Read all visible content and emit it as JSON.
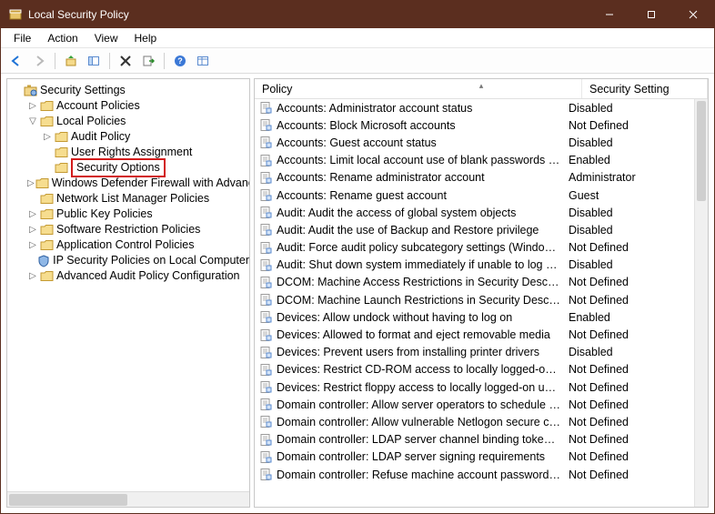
{
  "window": {
    "title": "Local Security Policy"
  },
  "menu": {
    "items": [
      "File",
      "Action",
      "View",
      "Help"
    ]
  },
  "tree": {
    "root_label": "Security Settings",
    "nodes": [
      {
        "label": "Account Policies",
        "depth": 1,
        "exp": ">",
        "icon": "folder"
      },
      {
        "label": "Local Policies",
        "depth": 1,
        "exp": "v",
        "icon": "folder"
      },
      {
        "label": "Audit Policy",
        "depth": 2,
        "exp": ">",
        "icon": "folder"
      },
      {
        "label": "User Rights Assignment",
        "depth": 2,
        "exp": "",
        "icon": "folder"
      },
      {
        "label": "Security Options",
        "depth": 2,
        "exp": "",
        "icon": "folder",
        "selected": true
      },
      {
        "label": "Windows Defender Firewall with Advanced Security",
        "depth": 1,
        "exp": ">",
        "icon": "folder"
      },
      {
        "label": "Network List Manager Policies",
        "depth": 1,
        "exp": "",
        "icon": "folder"
      },
      {
        "label": "Public Key Policies",
        "depth": 1,
        "exp": ">",
        "icon": "folder"
      },
      {
        "label": "Software Restriction Policies",
        "depth": 1,
        "exp": ">",
        "icon": "folder"
      },
      {
        "label": "Application Control Policies",
        "depth": 1,
        "exp": ">",
        "icon": "folder"
      },
      {
        "label": "IP Security Policies on Local Computer",
        "depth": 1,
        "exp": "",
        "icon": "shield"
      },
      {
        "label": "Advanced Audit Policy Configuration",
        "depth": 1,
        "exp": ">",
        "icon": "folder"
      }
    ]
  },
  "list": {
    "columns": {
      "policy": "Policy",
      "setting": "Security Setting"
    },
    "rows": [
      {
        "policy": "Accounts: Administrator account status",
        "setting": "Disabled"
      },
      {
        "policy": "Accounts: Block Microsoft accounts",
        "setting": "Not Defined"
      },
      {
        "policy": "Accounts: Guest account status",
        "setting": "Disabled"
      },
      {
        "policy": "Accounts: Limit local account use of blank passwords to co...",
        "setting": "Enabled"
      },
      {
        "policy": "Accounts: Rename administrator account",
        "setting": "Administrator"
      },
      {
        "policy": "Accounts: Rename guest account",
        "setting": "Guest"
      },
      {
        "policy": "Audit: Audit the access of global system objects",
        "setting": "Disabled"
      },
      {
        "policy": "Audit: Audit the use of Backup and Restore privilege",
        "setting": "Disabled"
      },
      {
        "policy": "Audit: Force audit policy subcategory settings (Windows Vis...",
        "setting": "Not Defined"
      },
      {
        "policy": "Audit: Shut down system immediately if unable to log secur...",
        "setting": "Disabled"
      },
      {
        "policy": "DCOM: Machine Access Restrictions in Security Descriptor D...",
        "setting": "Not Defined"
      },
      {
        "policy": "DCOM: Machine Launch Restrictions in Security Descriptor ...",
        "setting": "Not Defined"
      },
      {
        "policy": "Devices: Allow undock without having to log on",
        "setting": "Enabled"
      },
      {
        "policy": "Devices: Allowed to format and eject removable media",
        "setting": "Not Defined"
      },
      {
        "policy": "Devices: Prevent users from installing printer drivers",
        "setting": "Disabled"
      },
      {
        "policy": "Devices: Restrict CD-ROM access to locally logged-on user ...",
        "setting": "Not Defined"
      },
      {
        "policy": "Devices: Restrict floppy access to locally logged-on user only",
        "setting": "Not Defined"
      },
      {
        "policy": "Domain controller: Allow server operators to schedule tasks",
        "setting": "Not Defined"
      },
      {
        "policy": "Domain controller: Allow vulnerable Netlogon secure chann...",
        "setting": "Not Defined"
      },
      {
        "policy": "Domain controller: LDAP server channel binding token requi...",
        "setting": "Not Defined"
      },
      {
        "policy": "Domain controller: LDAP server signing requirements",
        "setting": "Not Defined"
      },
      {
        "policy": "Domain controller: Refuse machine account password chan...",
        "setting": "Not Defined"
      }
    ]
  }
}
